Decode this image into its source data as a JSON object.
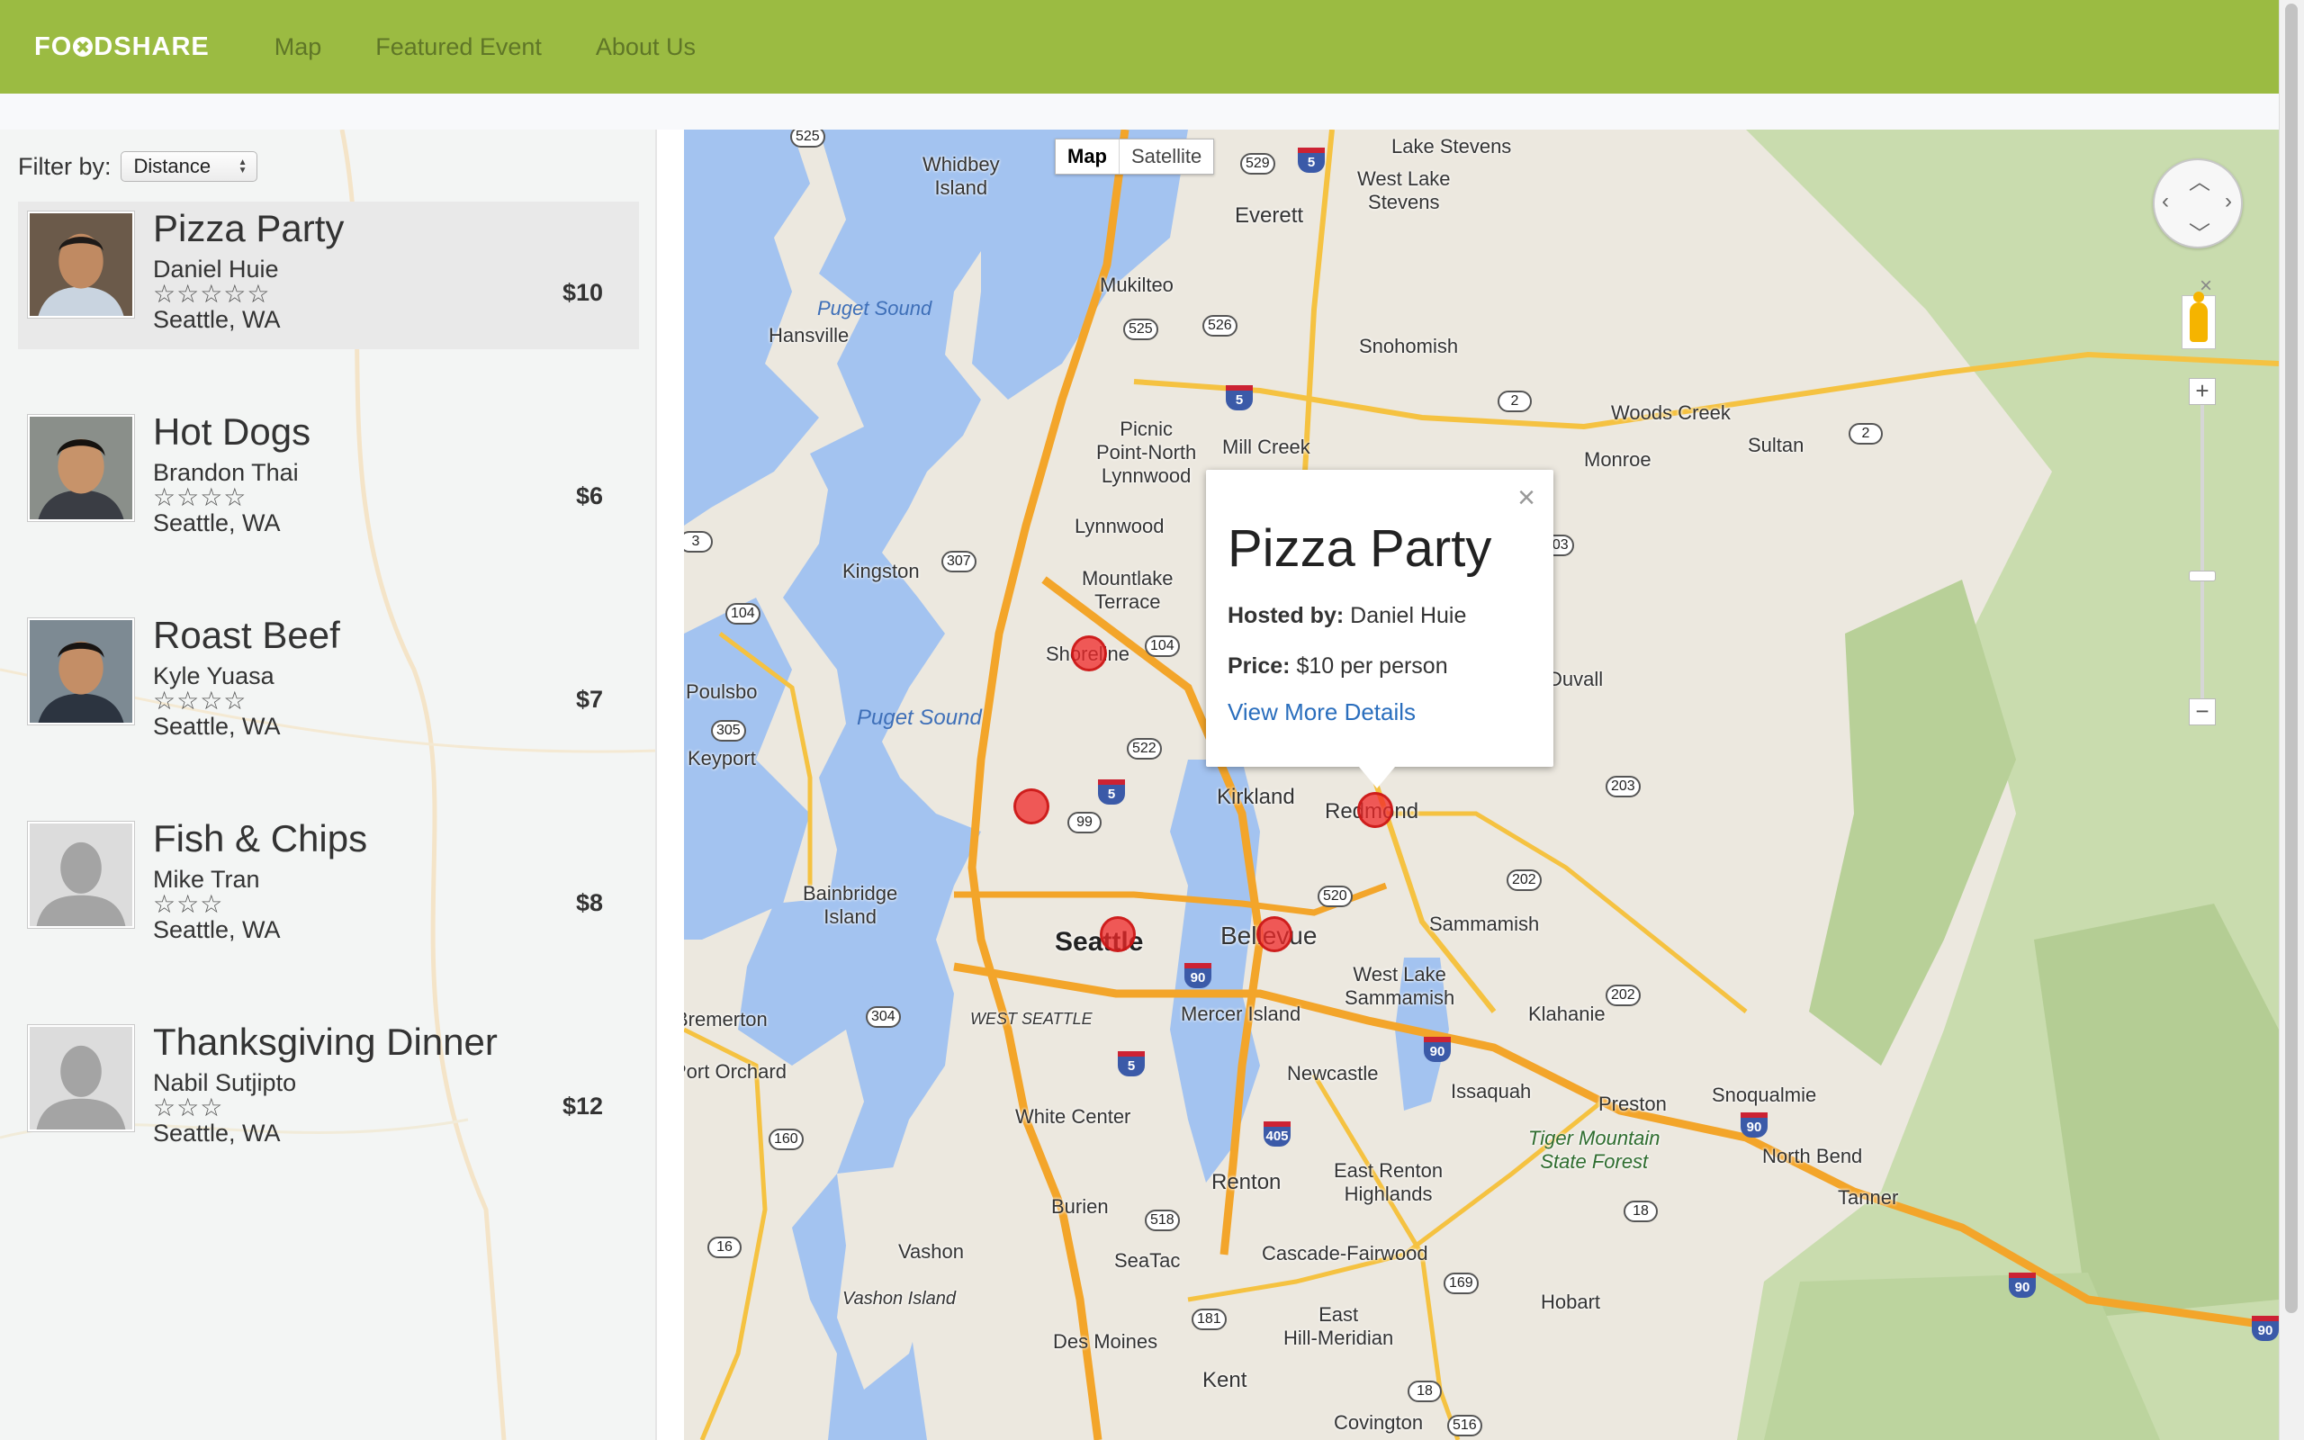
{
  "header": {
    "brand_pre": "FO",
    "brand_post": "DSHARE",
    "nav": [
      "Map",
      "Featured Event",
      "About Us"
    ],
    "accent": "#9bbb42"
  },
  "filter": {
    "label": "Filter by:",
    "selected": "Distance"
  },
  "events": [
    {
      "title": "Pizza Party",
      "host": "Daniel Huie",
      "stars": "☆☆☆☆☆",
      "location": "Seattle, WA",
      "price": "$10",
      "photo": "person-photo",
      "active": true
    },
    {
      "title": "Hot Dogs",
      "host": "Brandon Thai",
      "stars": "☆☆☆☆",
      "location": "Seattle, WA",
      "price": "$6",
      "photo": "person-photo"
    },
    {
      "title": "Roast Beef",
      "host": "Kyle Yuasa",
      "stars": "☆☆☆☆",
      "location": "Seattle, WA",
      "price": "$7",
      "photo": "person-photo"
    },
    {
      "title": "Fish & Chips",
      "host": "Mike Tran",
      "stars": "☆☆☆",
      "location": "Seattle, WA",
      "price": "$8",
      "photo": "placeholder-silhouette"
    },
    {
      "title": "Thanksgiving Dinner",
      "host": "Nabil Sutjipto",
      "stars": "☆☆☆",
      "location": "Seattle, WA",
      "price": "$12",
      "photo": "placeholder-silhouette"
    }
  ],
  "map": {
    "type_buttons": [
      "Map",
      "Satellite"
    ],
    "selected_type": "Map",
    "popup": {
      "title": "Pizza Party",
      "hosted_label": "Hosted by:",
      "hosted_value": "Daniel Huie",
      "price_label": "Price:",
      "price_value": "$10 per person",
      "link": "View More Details",
      "close": "×"
    },
    "labels": {
      "whidbey": "Whidbey\nIsland",
      "everett": "Everett",
      "mukilteo": "Mukilteo",
      "lake_stevens": "Lake Stevens",
      "west_lake_stevens": "West Lake\nStevens",
      "snohomish": "Snohomish",
      "puget_sound_1": "Puget Sound",
      "hansville": "Hansville",
      "woods_creek": "Woods Creek",
      "sultan": "Sultan",
      "monroe": "Monroe",
      "picnic_point": "Picnic\nPoint-North\nLynnwood",
      "mill_creek": "Mill Creek",
      "lynnwood": "Lynnwood",
      "kingston": "Kingston",
      "mountlake": "Mountlake\nTerrace",
      "shoreline": "Shoreline",
      "poulsbo": "Poulsbo",
      "puget_sound_2": "Puget Sound",
      "keyport": "Keyport",
      "kirkland": "Kirkland",
      "redmond": "Redmond",
      "duvall": "Duvall",
      "bainbridge": "Bainbridge\nIsland",
      "seattle": "Seattle",
      "bellevue": "Bellevue",
      "sammamish": "Sammamish",
      "west_lake_sammamish": "West Lake\nSammamish",
      "klahanie": "Klahanie",
      "bremerton": "Bremerton",
      "west_seattle": "WEST SEATTLE",
      "mercer_island": "Mercer Island",
      "port_orchard": "Port Orchard",
      "newcastle": "Newcastle",
      "issaquah": "Issaquah",
      "preston": "Preston",
      "snoqualmie": "Snoqualmie",
      "white_center": "White Center",
      "tiger_mountain": "Tiger Mountain\nState Forest",
      "north_bend": "North Bend",
      "tanner": "Tanner",
      "renton": "Renton",
      "east_renton": "East Renton\nHighlands",
      "burien": "Burien",
      "vashon": "Vashon",
      "seatac": "SeaTac",
      "cascade_fairwood": "Cascade-Fairwood",
      "vashon_island": "Vashon Island",
      "hobart": "Hobart",
      "des_moines": "Des Moines",
      "east_hill": "East\nHill-Meridian",
      "kent": "Kent",
      "covington": "Covington"
    },
    "shields": [
      "525",
      "529",
      "5",
      "526",
      "525",
      "5",
      "2",
      "2",
      "203",
      "3",
      "104",
      "307",
      "104",
      "522",
      "5",
      "305",
      "99",
      "203",
      "202",
      "520",
      "90",
      "202",
      "304",
      "90",
      "5",
      "405",
      "160",
      "90",
      "18",
      "16",
      "518",
      "169",
      "90",
      "181",
      "18",
      "516",
      "90"
    ]
  }
}
